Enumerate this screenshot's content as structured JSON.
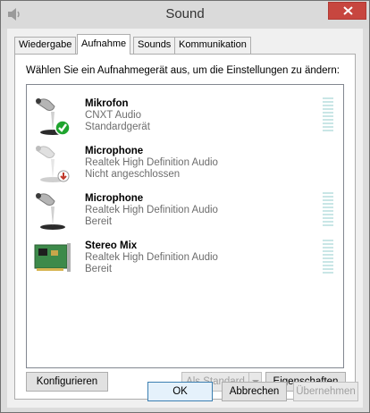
{
  "window": {
    "title": "Sound",
    "close_label": "✕"
  },
  "tabs": [
    {
      "label": "Wiedergabe",
      "active": false
    },
    {
      "label": "Aufnahme",
      "active": true
    },
    {
      "label": "Sounds",
      "active": false
    },
    {
      "label": "Kommunikation",
      "active": false
    }
  ],
  "panel": {
    "instruction": "Wählen Sie ein Aufnahmegerät aus, um die Einstellungen zu ändern:"
  },
  "devices": [
    {
      "name": "Mikrofon",
      "driver": "CNXT Audio",
      "status": "Standardgerät",
      "icon": "microphone-default-icon"
    },
    {
      "name": "Microphone",
      "driver": "Realtek High Definition Audio",
      "status": "Nicht angeschlossen",
      "icon": "microphone-unplugged-icon"
    },
    {
      "name": "Microphone",
      "driver": "Realtek High Definition Audio",
      "status": "Bereit",
      "icon": "microphone-icon"
    },
    {
      "name": "Stereo Mix",
      "driver": "Realtek High Definition Audio",
      "status": "Bereit",
      "icon": "sound-card-icon"
    }
  ],
  "buttons": {
    "configure": "Konfigurieren",
    "set_default": "Als Standard",
    "properties": "Eigenschaften",
    "ok": "OK",
    "cancel": "Abbrechen",
    "apply": "Übernehmen"
  }
}
